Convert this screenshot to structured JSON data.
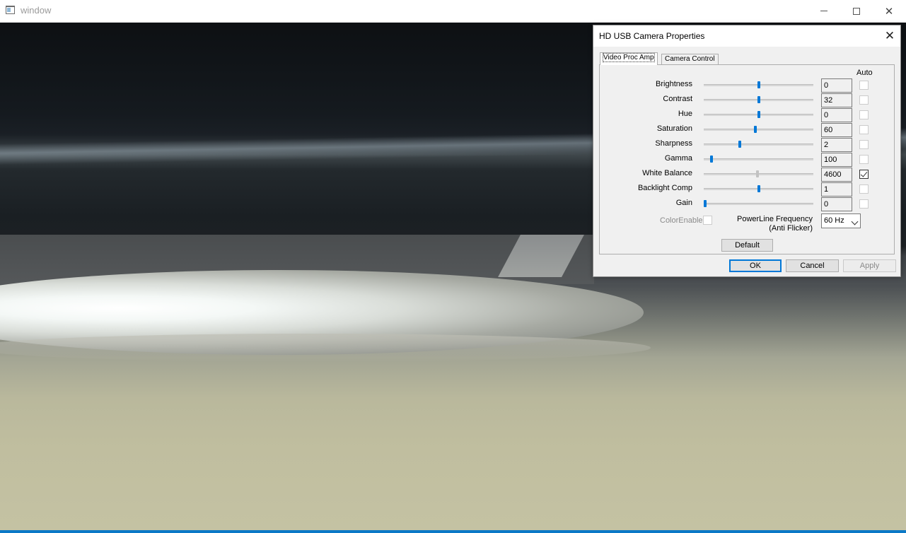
{
  "window": {
    "title": "window",
    "controls": {
      "minimize_icon": "minimize-icon",
      "maximize_icon": "maximize-icon",
      "close_icon": "close-icon",
      "close_glyph": "✕"
    }
  },
  "dialog": {
    "title": "HD USB Camera Properties",
    "close_glyph": "✕",
    "tabs": [
      {
        "label": "Video Proc Amp",
        "selected": true
      },
      {
        "label": "Camera Control",
        "selected": false
      }
    ],
    "auto_header": "Auto",
    "properties": [
      {
        "label": "Brightness",
        "value": "0",
        "slider_fraction": 0.5,
        "auto": false,
        "enabled": true
      },
      {
        "label": "Contrast",
        "value": "32",
        "slider_fraction": 0.5,
        "auto": false,
        "enabled": true
      },
      {
        "label": "Hue",
        "value": "0",
        "slider_fraction": 0.5,
        "auto": false,
        "enabled": true
      },
      {
        "label": "Saturation",
        "value": "60",
        "slider_fraction": 0.47,
        "auto": false,
        "enabled": true
      },
      {
        "label": "Sharpness",
        "value": "2",
        "slider_fraction": 0.33,
        "auto": false,
        "enabled": true
      },
      {
        "label": "Gamma",
        "value": "100",
        "slider_fraction": 0.07,
        "auto": false,
        "enabled": true
      },
      {
        "label": "White Balance",
        "value": "4600",
        "slider_fraction": 0.49,
        "auto": true,
        "enabled": false
      },
      {
        "label": "Backlight Comp",
        "value": "1",
        "slider_fraction": 0.5,
        "auto": false,
        "enabled": true
      },
      {
        "label": "Gain",
        "value": "0",
        "slider_fraction": 0.01,
        "auto": false,
        "enabled": true
      }
    ],
    "color_enable": {
      "label": "ColorEnable",
      "checked": false,
      "enabled": false
    },
    "powerline": {
      "label_line1": "PowerLine Frequency",
      "label_line2": "(Anti Flicker)",
      "value": "60 Hz"
    },
    "buttons": {
      "default": "Default",
      "ok": "OK",
      "cancel": "Cancel",
      "apply": "Apply"
    }
  },
  "colors": {
    "accent": "#0078d7",
    "window_border": "#0b79c7",
    "dialog_bg": "#f0f0f0"
  }
}
